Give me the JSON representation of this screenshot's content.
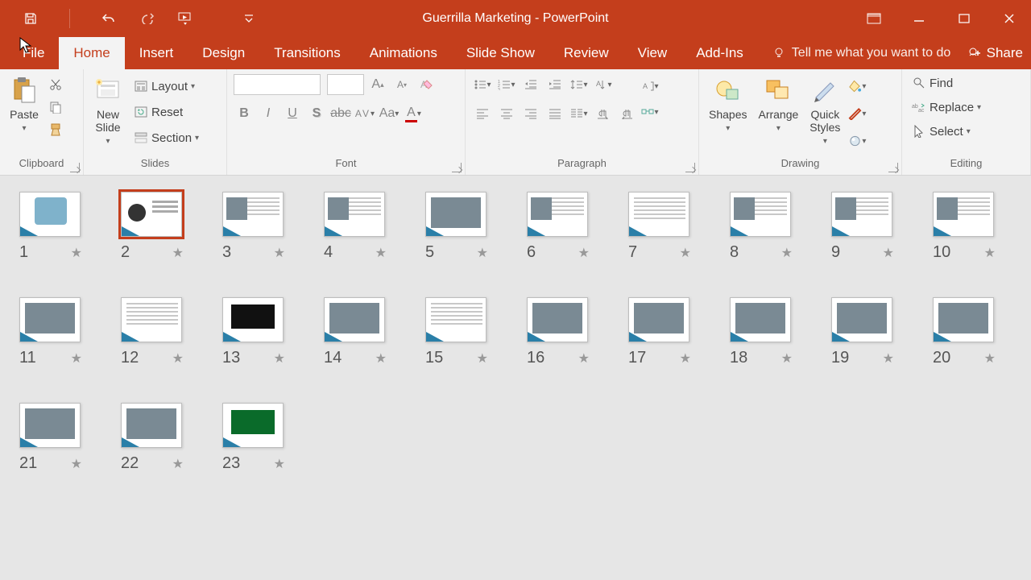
{
  "app": {
    "title": "Guerrilla Marketing - PowerPoint"
  },
  "tabs": {
    "file": "File",
    "home": "Home",
    "insert": "Insert",
    "design": "Design",
    "transitions": "Transitions",
    "animations": "Animations",
    "slideshow": "Slide Show",
    "review": "Review",
    "view": "View",
    "addins": "Add-Ins",
    "tellme": "Tell me what you want to do",
    "share": "Share"
  },
  "groups": {
    "clipboard": {
      "label": "Clipboard",
      "paste": "Paste"
    },
    "slides": {
      "label": "Slides",
      "newslide": "New\nSlide",
      "layout": "Layout",
      "reset": "Reset",
      "section": "Section"
    },
    "font": {
      "label": "Font"
    },
    "paragraph": {
      "label": "Paragraph"
    },
    "drawing": {
      "label": "Drawing",
      "shapes": "Shapes",
      "arrange": "Arrange",
      "quickstyles": "Quick\nStyles"
    },
    "editing": {
      "label": "Editing",
      "find": "Find",
      "replace": "Replace",
      "select": "Select"
    }
  },
  "slides_view": {
    "selected": 2,
    "count": 23
  }
}
